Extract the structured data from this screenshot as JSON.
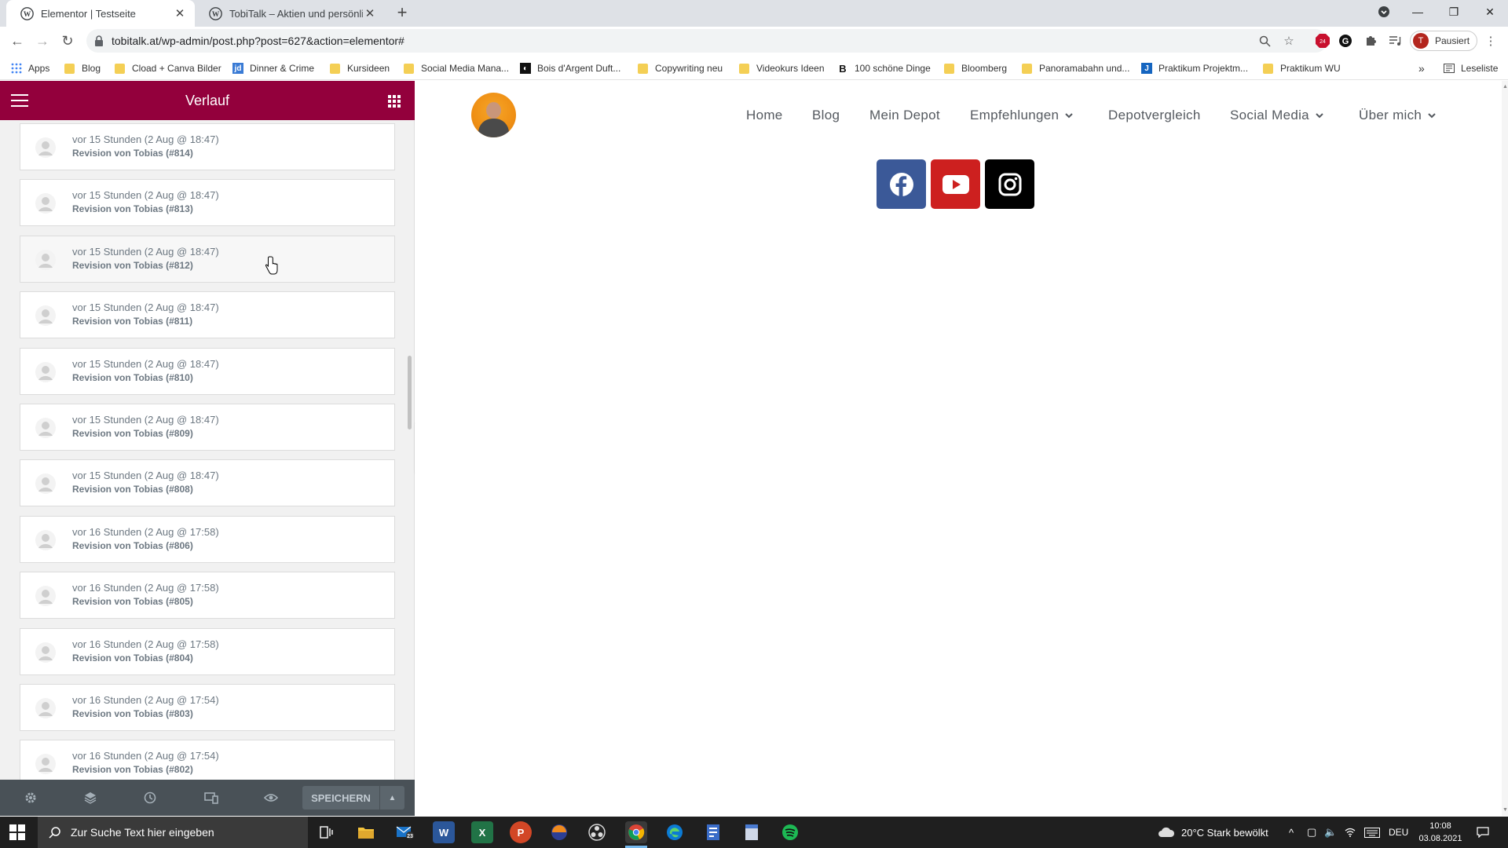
{
  "browser": {
    "tabs": [
      {
        "title": "Elementor | Testseite",
        "active": true
      },
      {
        "title": "TobiTalk – Aktien und persönlich",
        "active": false
      }
    ],
    "url_host": "tobitalk.at",
    "url_path": "/wp-admin/post.php?post=627&action=elementor#",
    "profile_initial": "T",
    "profile_status": "Pausiert",
    "extension_badge": "24",
    "bookmarks": [
      {
        "label": "Apps",
        "icon": "apps-grid-icon"
      },
      {
        "label": "Blog",
        "icon": "folder-icon"
      },
      {
        "label": "Cload + Canva Bilder",
        "icon": "folder-icon"
      },
      {
        "label": "Dinner & Crime",
        "icon": "jd-icon"
      },
      {
        "label": "Kursideen",
        "icon": "folder-icon"
      },
      {
        "label": "Social Media Mana...",
        "icon": "folder-icon"
      },
      {
        "label": "Bois d'Argent Duft...",
        "icon": "bois-icon"
      },
      {
        "label": "Copywriting neu",
        "icon": "folder-icon"
      },
      {
        "label": "Videokurs Ideen",
        "icon": "folder-icon"
      },
      {
        "label": "100 schöne Dinge",
        "icon": "b-icon"
      },
      {
        "label": "Bloomberg",
        "icon": "folder-icon"
      },
      {
        "label": "Panoramabahn und...",
        "icon": "folder-icon"
      },
      {
        "label": "Praktikum Projektm...",
        "icon": "j-icon"
      },
      {
        "label": "Praktikum WU",
        "icon": "folder-icon"
      }
    ],
    "more_bookmarks": "»",
    "reading_list": "Leseliste",
    "accent_color": "#93003c"
  },
  "panel": {
    "title": "Verlauf",
    "revisions": [
      {
        "time": "vor 15 Stunden (2 Aug @ 18:47)",
        "name": "Revision von Tobias (#814)"
      },
      {
        "time": "vor 15 Stunden (2 Aug @ 18:47)",
        "name": "Revision von Tobias (#813)"
      },
      {
        "time": "vor 15 Stunden (2 Aug @ 18:47)",
        "name": "Revision von Tobias (#812)"
      },
      {
        "time": "vor 15 Stunden (2 Aug @ 18:47)",
        "name": "Revision von Tobias (#811)"
      },
      {
        "time": "vor 15 Stunden (2 Aug @ 18:47)",
        "name": "Revision von Tobias (#810)"
      },
      {
        "time": "vor 15 Stunden (2 Aug @ 18:47)",
        "name": "Revision von Tobias (#809)"
      },
      {
        "time": "vor 15 Stunden (2 Aug @ 18:47)",
        "name": "Revision von Tobias (#808)"
      },
      {
        "time": "vor 16 Stunden (2 Aug @ 17:58)",
        "name": "Revision von Tobias (#806)"
      },
      {
        "time": "vor 16 Stunden (2 Aug @ 17:58)",
        "name": "Revision von Tobias (#805)"
      },
      {
        "time": "vor 16 Stunden (2 Aug @ 17:58)",
        "name": "Revision von Tobias (#804)"
      },
      {
        "time": "vor 16 Stunden (2 Aug @ 17:54)",
        "name": "Revision von Tobias (#803)"
      },
      {
        "time": "vor 16 Stunden (2 Aug @ 17:54)",
        "name": "Revision von Tobias (#802)"
      }
    ],
    "save_label": "SPEICHERN"
  },
  "site": {
    "menu": [
      {
        "label": "Home",
        "dropdown": false
      },
      {
        "label": "Blog",
        "dropdown": false
      },
      {
        "label": "Mein Depot",
        "dropdown": false
      },
      {
        "label": "Empfehlungen",
        "dropdown": true
      },
      {
        "label": "Depotvergleich",
        "dropdown": false
      },
      {
        "label": "Social Media",
        "dropdown": true
      },
      {
        "label": "Über mich",
        "dropdown": true
      }
    ],
    "social": [
      {
        "name": "facebook-icon",
        "color": "#3b5998"
      },
      {
        "name": "youtube-icon",
        "color": "#cd201f"
      },
      {
        "name": "instagram-icon",
        "color": "#000000"
      }
    ]
  },
  "taskbar": {
    "search_placeholder": "Zur Suche Text hier eingeben",
    "mail_badge": "23",
    "weather": "20°C  Stark bewölkt",
    "language": "DEU",
    "time": "10:08",
    "date": "03.08.2021"
  }
}
